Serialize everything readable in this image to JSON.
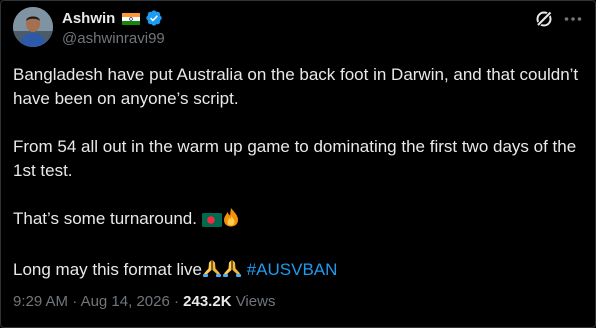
{
  "author": {
    "display_name": "Ashwin",
    "handle": "@ashwinravi99",
    "flag_icon": "india-flag-icon",
    "verified_icon": "verified-badge-icon",
    "verified_color": "#1d9bf0"
  },
  "actions": {
    "grok_icon": "grok-icon",
    "more_icon": "more-icon"
  },
  "tweet": {
    "line1": "Bangladesh have put Australia on the back foot in Darwin, and that couldn’t have been on anyone’s script.",
    "line2": "From 54 all out in the warm up game to dominating the first two days of the 1st test.",
    "line3": "That’s some turnaround.",
    "line3_emojis": [
      "bangladesh-flag-icon",
      "fire-icon"
    ],
    "line4": "Long may this format live",
    "line4_emojis": [
      "folded-hands-icon",
      "folded-hands-icon"
    ],
    "hashtag": "#AUSVBAN",
    "hashtag_color": "#1d9bf0"
  },
  "meta": {
    "time": "9:29 AM",
    "separator": "·",
    "date": "Aug 14, 2026",
    "views_count": "243.2K",
    "views_label": "Views"
  },
  "colors": {
    "background": "#000000",
    "text": "#e7e9ea",
    "secondary": "#71767b",
    "border": "#2f3336"
  }
}
